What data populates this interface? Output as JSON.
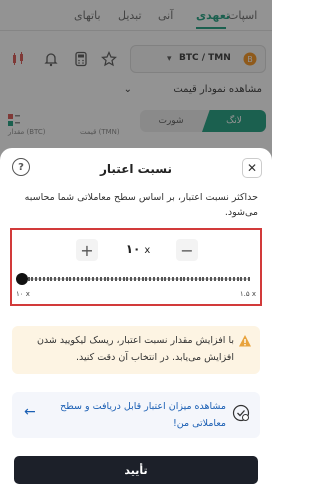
{
  "background": {
    "tabs": [
      "اسپات",
      "تعهدی",
      "آنی",
      "تبدیل",
      "باتهای"
    ],
    "active_tab": "تعهدی",
    "pair": "BTC / TMN",
    "chart_link": "مشاهده نمودار قیمت",
    "side_long": "لانگ",
    "side_short": "شورت",
    "orderbook_price_head": "قیمت (TMN)",
    "orderbook_amount_head": "مقدار (BTC)"
  },
  "sheet": {
    "title": "نسبت اعتبار",
    "description": "حداکثر نسبت اعتبار، بر اساس سطح معاملاتی شما محاسبه می‌شود.",
    "leverage_value": "۱۰",
    "leverage_unit": "x",
    "min_label": "۱۰ x",
    "max_label": "۱.۵ x",
    "slider_fraction": 0,
    "warning": "با افزایش مقدار نسبت اعتبار، ریسک لیکویید شدن افزایش می‌یابد. در انتخاب آن دقت کنید.",
    "info": "مشاهده میزان اعتبار قابل دریافت و سطح معاملاتی من!",
    "confirm": "تأیید"
  },
  "colors": {
    "accent": "#1a9e7d",
    "highlight_border": "#d23a3a",
    "confirm_bg": "#1c2029",
    "info_text": "#1a5fb4",
    "warning_bg": "#fdf4e3"
  }
}
